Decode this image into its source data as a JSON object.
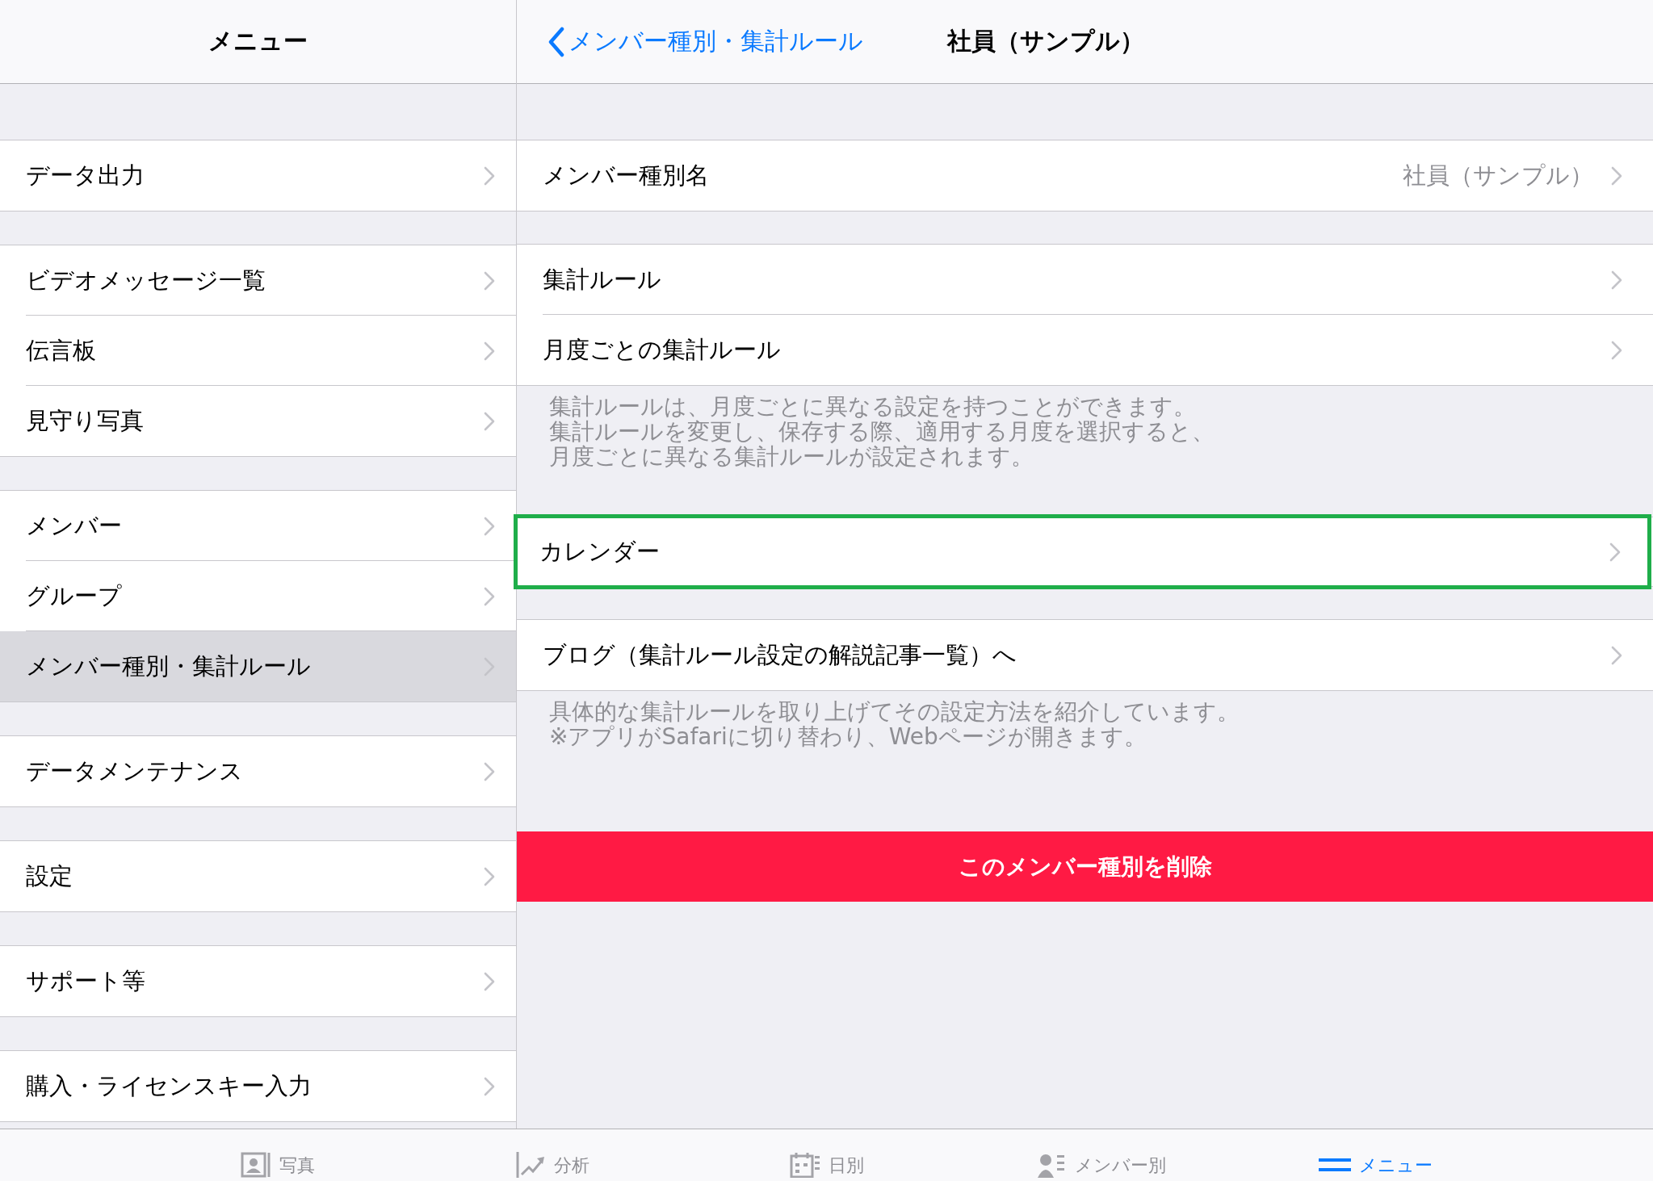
{
  "menu": {
    "title": "メニュー",
    "groups": [
      {
        "items": [
          {
            "label": "データ出力",
            "selected": false
          }
        ]
      },
      {
        "items": [
          {
            "label": "ビデオメッセージ一覧",
            "selected": false
          },
          {
            "label": "伝言板",
            "selected": false
          },
          {
            "label": "見守り写真",
            "selected": false
          }
        ]
      },
      {
        "items": [
          {
            "label": "メンバー",
            "selected": false
          },
          {
            "label": "グループ",
            "selected": false
          },
          {
            "label": "メンバー種別・集計ルール",
            "selected": true
          }
        ]
      },
      {
        "items": [
          {
            "label": "データメンテナンス",
            "selected": false
          }
        ]
      },
      {
        "items": [
          {
            "label": "設定",
            "selected": false
          }
        ]
      },
      {
        "items": [
          {
            "label": "サポート等",
            "selected": false
          }
        ]
      },
      {
        "items": [
          {
            "label": "購入・ライセンスキー入力",
            "selected": false
          }
        ]
      }
    ]
  },
  "detail": {
    "back": "メンバー種別・集計ルール",
    "title": "社員（サンプル）",
    "sections": [
      {
        "rows": [
          {
            "label": "メンバー種別名",
            "value": "社員（サンプル）",
            "highlighted": false
          }
        ]
      },
      {
        "rows": [
          {
            "label": "集計ルール",
            "highlighted": false
          },
          {
            "label": "月度ごとの集計ルール",
            "highlighted": false
          }
        ],
        "footer": [
          "集計ルールは、月度ごとに異なる設定を持つことができます。",
          "集計ルールを変更し、保存する際、適用する月度を選択すると、",
          "月度ごとに異なる集計ルールが設定されます。"
        ]
      },
      {
        "rows": [
          {
            "label": "カレンダー",
            "highlighted": true
          }
        ]
      },
      {
        "rows": [
          {
            "label": "ブログ（集計ルール設定の解説記事一覧）へ",
            "highlighted": false
          }
        ],
        "footer": [
          "具体的な集計ルールを取り上げてその設定方法を紹介しています。",
          "※アプリがSafariに切り替わり、Webページが開きます。"
        ]
      }
    ],
    "delete_button": "このメンバー種別を削除"
  },
  "tab_bar": [
    {
      "kind": "photo",
      "label": "写真",
      "selected": false
    },
    {
      "kind": "chart",
      "label": "分析",
      "selected": false
    },
    {
      "kind": "calendar",
      "label": "日別",
      "selected": false
    },
    {
      "kind": "member",
      "label": "メンバー別",
      "selected": false
    },
    {
      "kind": "menu",
      "label": "メニュー",
      "selected": true
    }
  ]
}
